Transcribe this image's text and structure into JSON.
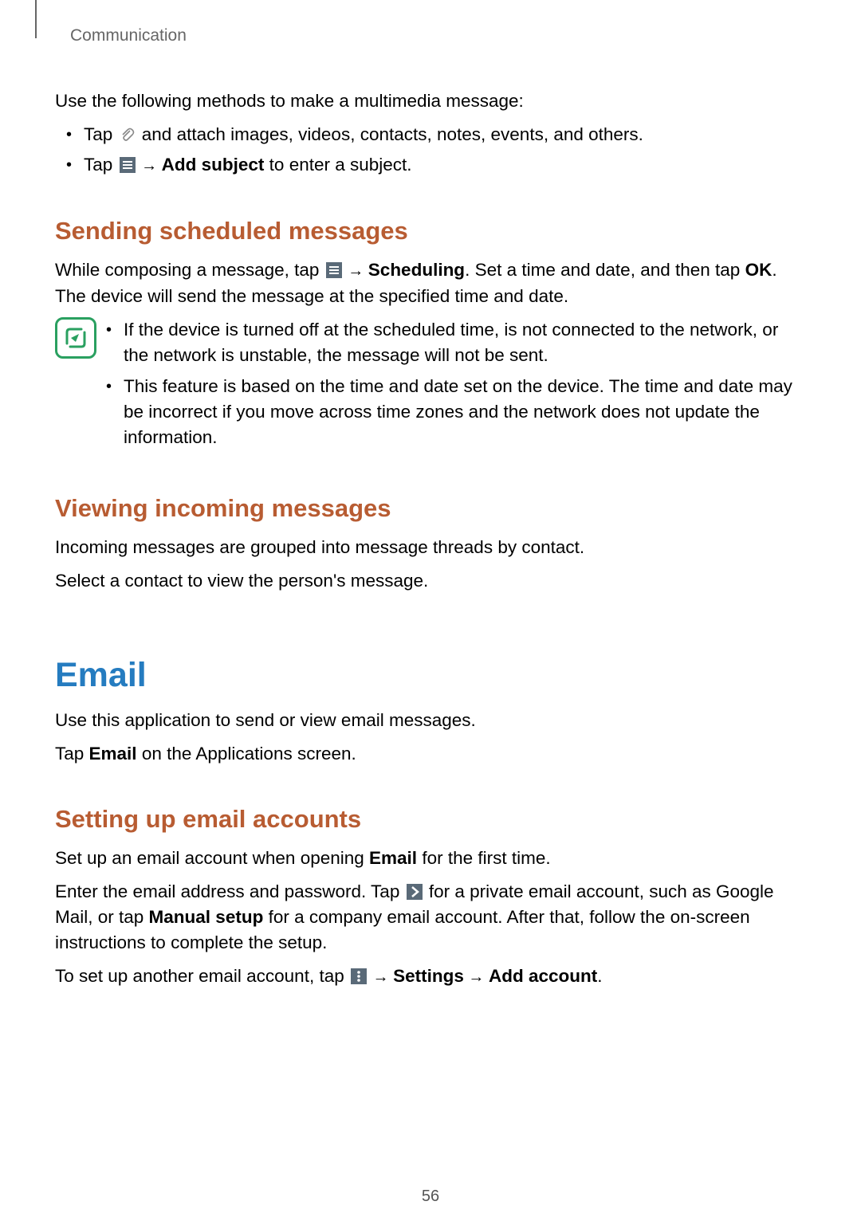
{
  "header": {
    "breadcrumb": "Communication"
  },
  "intro": "Use the following methods to make a multimedia message:",
  "bullets": [
    {
      "pre": "Tap ",
      "post": " and attach images, videos, contacts, notes, events, and others."
    },
    {
      "pre": "Tap ",
      "arrow": " → ",
      "bold": "Add subject",
      "post": " to enter a subject."
    }
  ],
  "sec1": {
    "title": "Sending scheduled messages",
    "p1_pre": "While composing a message, tap ",
    "p1_arrow": " → ",
    "p1_bold1": "Scheduling",
    "p1_mid": ". Set a time and date, and then tap ",
    "p1_bold2": "OK",
    "p1_end": ". The device will send the message at the specified time and date.",
    "notes": [
      "If the device is turned off at the scheduled time, is not connected to the network, or the network is unstable, the message will not be sent.",
      "This feature is based on the time and date set on the device. The time and date may be incorrect if you move across time zones and the network does not update the information."
    ]
  },
  "sec2": {
    "title": "Viewing incoming messages",
    "p1": "Incoming messages are grouped into message threads by contact.",
    "p2": "Select a contact to view the person's message."
  },
  "email": {
    "title": "Email",
    "p1": "Use this application to send or view email messages.",
    "p2_pre": "Tap ",
    "p2_bold": "Email",
    "p2_post": " on the Applications screen."
  },
  "sec3": {
    "title": "Setting up email accounts",
    "p1_pre": "Set up an email account when opening ",
    "p1_bold": "Email",
    "p1_post": " for the first time.",
    "p2_pre": "Enter the email address and password. Tap ",
    "p2_mid": " for a private email account, such as Google Mail, or tap ",
    "p2_bold": "Manual setup",
    "p2_post": " for a company email account. After that, follow the on-screen instructions to complete the setup.",
    "p3_pre": "To set up another email account, tap ",
    "p3_arrow": " → ",
    "p3_bold1": "Settings",
    "p3_arrow2": " → ",
    "p3_bold2": "Add account",
    "p3_end": "."
  },
  "pageNumber": "56"
}
